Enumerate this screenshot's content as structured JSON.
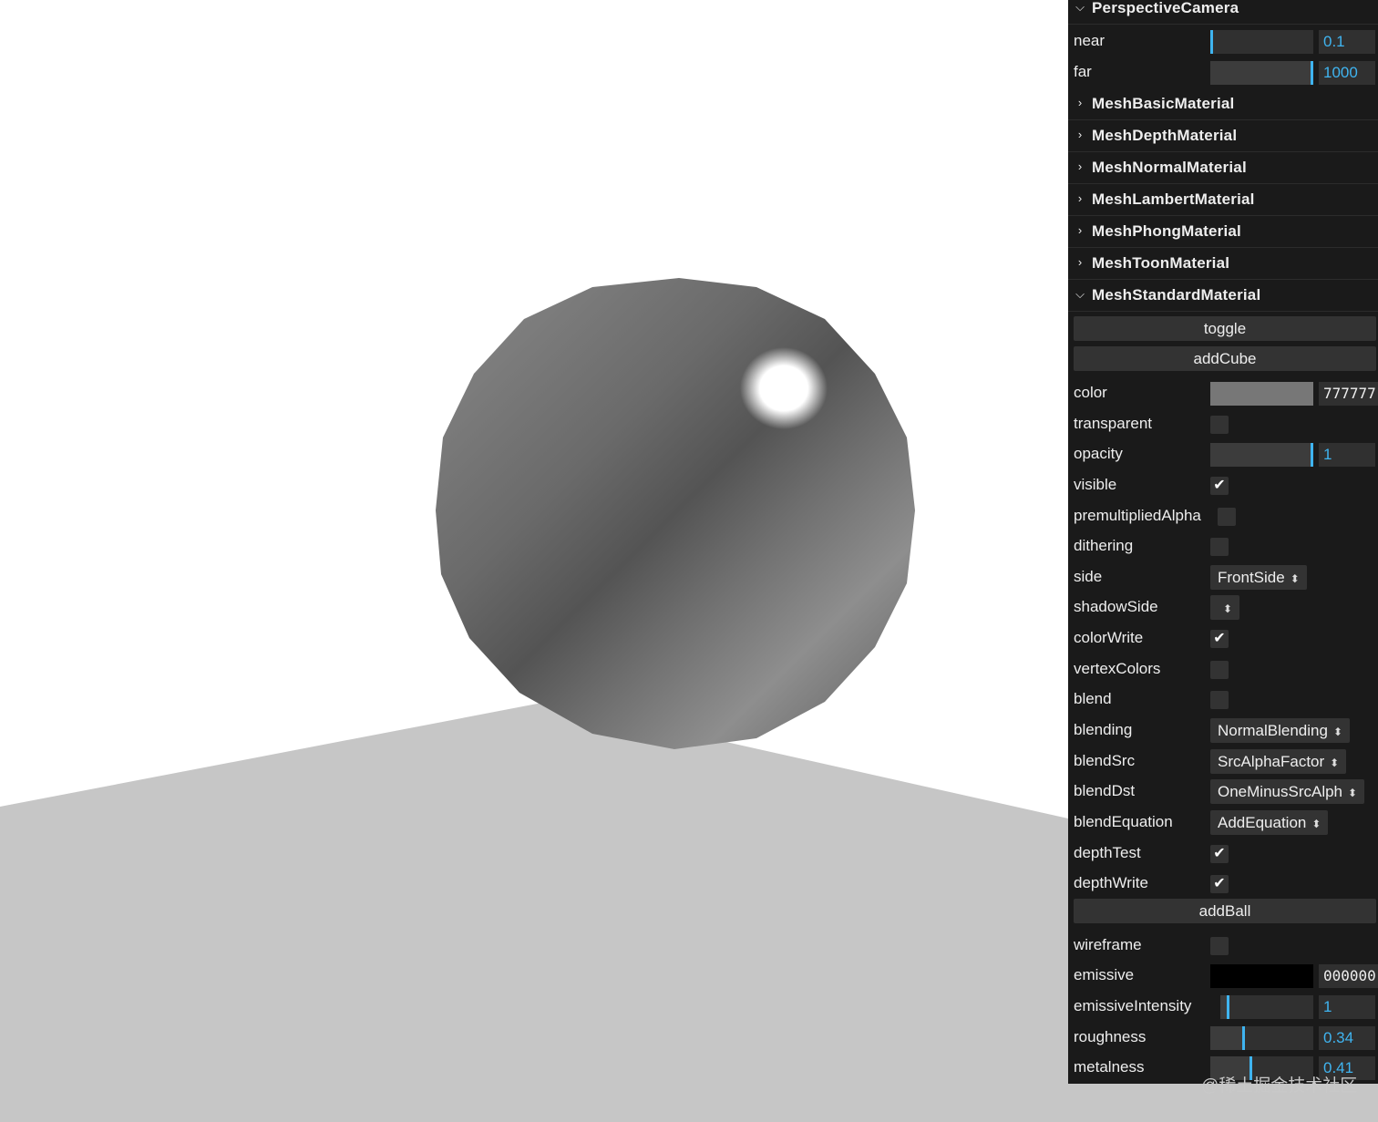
{
  "scene": {
    "background_color": "#ffffff",
    "floor_color": "#c6c6c6",
    "sphere_color": "#777777"
  },
  "panel": {
    "camera_folder": {
      "title": "PerspectiveCamera",
      "near": {
        "label": "near",
        "value": "0.1",
        "fill": 0.0
      },
      "far": {
        "label": "far",
        "value": "1000",
        "fill": 1.0
      }
    },
    "collapsed_folders": [
      "MeshBasicMaterial",
      "MeshDepthMaterial",
      "MeshNormalMaterial",
      "MeshLambertMaterial",
      "MeshPhongMaterial",
      "MeshToonMaterial"
    ],
    "standard_folder": {
      "title": "MeshStandardMaterial",
      "toggle_label": "toggle",
      "add_cube_label": "addCube",
      "color": {
        "label": "color",
        "value": "777777",
        "swatch": "#777777"
      },
      "transparent": {
        "label": "transparent",
        "checked": false
      },
      "opacity": {
        "label": "opacity",
        "value": "1",
        "fill": 1.0
      },
      "visible": {
        "label": "visible",
        "checked": true
      },
      "premultiplied_alpha": {
        "label": "premultipliedAlpha",
        "checked": false
      },
      "dithering": {
        "label": "dithering",
        "checked": false
      },
      "side": {
        "label": "side",
        "value": "FrontSide"
      },
      "shadow_side": {
        "label": "shadowSide",
        "value": ""
      },
      "color_write": {
        "label": "colorWrite",
        "checked": true
      },
      "vertex_colors": {
        "label": "vertexColors",
        "checked": false
      },
      "blend": {
        "label": "blend",
        "checked": false
      },
      "blending": {
        "label": "blending",
        "value": "NormalBlending"
      },
      "blend_src": {
        "label": "blendSrc",
        "value": "SrcAlphaFactor"
      },
      "blend_dst": {
        "label": "blendDst",
        "value": "OneMinusSrcAlph"
      },
      "blend_equation": {
        "label": "blendEquation",
        "value": "AddEquation"
      },
      "depth_test": {
        "label": "depthTest",
        "checked": true
      },
      "depth_write": {
        "label": "depthWrite",
        "checked": true
      },
      "add_ball_label": "addBall",
      "wireframe": {
        "label": "wireframe",
        "checked": false
      },
      "emissive": {
        "label": "emissive",
        "value": "000000",
        "swatch": "#000000"
      },
      "emissive_intensity": {
        "label": "emissiveIntensity",
        "value": "1",
        "fill": 0.1
      },
      "roughness": {
        "label": "roughness",
        "value": "0.34",
        "fill": 0.34
      },
      "metalness": {
        "label": "metalness",
        "value": "0.41",
        "fill": 0.41
      }
    }
  },
  "watermark": "@稀土掘金技术社区"
}
